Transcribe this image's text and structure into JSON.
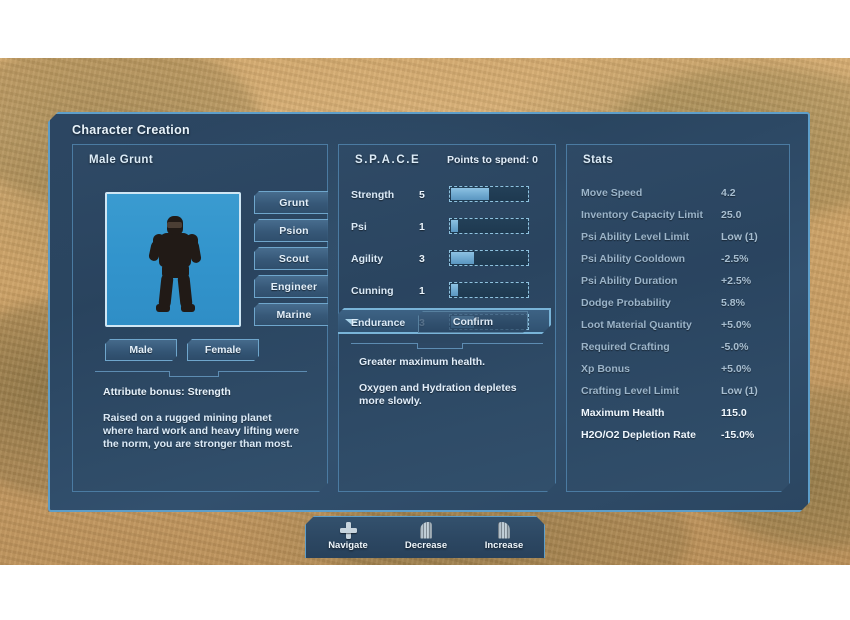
{
  "window": {
    "title": "Character Creation"
  },
  "left_panel": {
    "title": "Male Grunt",
    "portrait_icon": "character-silhouette",
    "classes": [
      {
        "label": "Grunt"
      },
      {
        "label": "Psion"
      },
      {
        "label": "Scout"
      },
      {
        "label": "Engineer"
      },
      {
        "label": "Marine"
      }
    ],
    "genders": [
      {
        "label": "Male"
      },
      {
        "label": "Female"
      }
    ],
    "attribute_bonus": "Attribute bonus: Strength",
    "description": "Raised on a rugged mining planet where hard work and heavy lifting were the norm, you are stronger than most."
  },
  "mid_panel": {
    "title": "S.P.A.C.E",
    "points_label": "Points to spend: 0",
    "attributes": [
      {
        "name": "Strength",
        "value": "5",
        "fill_pct": 50,
        "selected": false
      },
      {
        "name": "Psi",
        "value": "1",
        "fill_pct": 10,
        "selected": false
      },
      {
        "name": "Agility",
        "value": "3",
        "fill_pct": 30,
        "selected": false
      },
      {
        "name": "Cunning",
        "value": "1",
        "fill_pct": 10,
        "selected": false
      },
      {
        "name": "Endurance",
        "value": "3",
        "fill_pct": 30,
        "selected": true
      }
    ],
    "confirm_label": "Confirm",
    "perk_lines": [
      "Greater maximum health.",
      "Oxygen and Hydration depletes more slowly."
    ]
  },
  "right_panel": {
    "title": "Stats",
    "stats": [
      {
        "label": "Move Speed",
        "value": "4.2",
        "highlight": false
      },
      {
        "label": "Inventory Capacity Limit",
        "value": "25.0",
        "highlight": false
      },
      {
        "label": "Psi Ability Level Limit",
        "value": "Low (1)",
        "highlight": false
      },
      {
        "label": "Psi Ability Cooldown",
        "value": "-2.5%",
        "highlight": false
      },
      {
        "label": "Psi Ability Duration",
        "value": "+2.5%",
        "highlight": false
      },
      {
        "label": "Dodge Probability",
        "value": "5.8%",
        "highlight": false
      },
      {
        "label": "Loot Material Quantity",
        "value": "+5.0%",
        "highlight": false
      },
      {
        "label": "Required Crafting",
        "value": "-5.0%",
        "highlight": false
      },
      {
        "label": "Xp Bonus",
        "value": "+5.0%",
        "highlight": false
      },
      {
        "label": "Crafting Level Limit",
        "value": "Low (1)",
        "highlight": false
      },
      {
        "label": "Maximum Health",
        "value": "115.0",
        "highlight": true
      },
      {
        "label": "H2O/O2 Depletion Rate",
        "value": "-15.0%",
        "highlight": true
      }
    ]
  },
  "control_bar": {
    "controls": [
      {
        "label": "Navigate",
        "icon": "dpad-icon"
      },
      {
        "label": "Decrease",
        "icon": "left-trigger-icon"
      },
      {
        "label": "Increase",
        "icon": "right-trigger-icon"
      }
    ]
  },
  "colors": {
    "accent_border": "#5e9ec9",
    "panel_bg": "#2d4864",
    "portrait_bg": "#3294cc",
    "slider_fill": "#7fb6da",
    "terrain": "#cfa469"
  }
}
